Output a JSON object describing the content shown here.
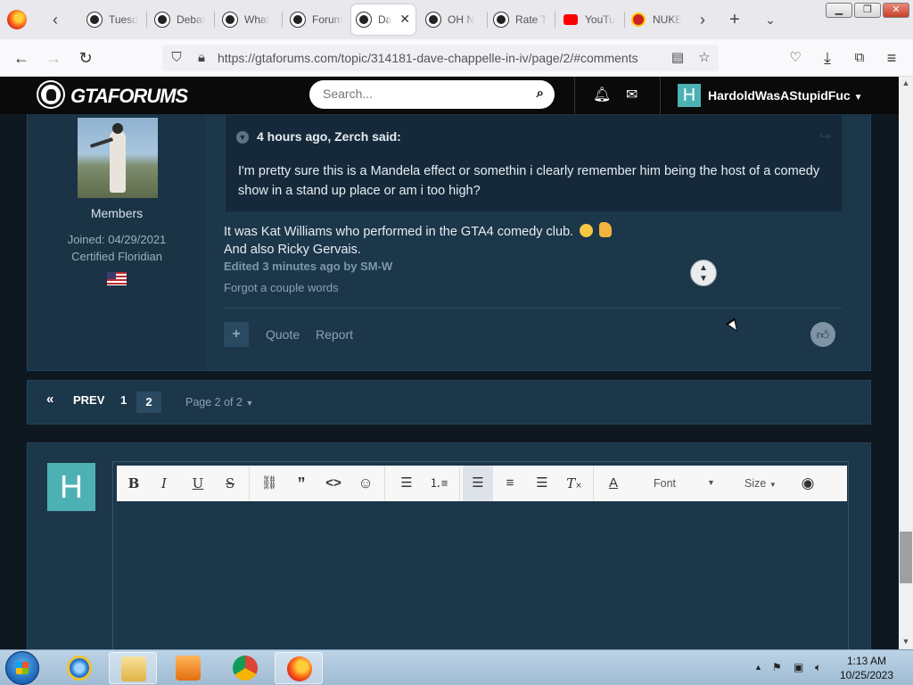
{
  "browser": {
    "tabs": [
      {
        "title": "Tuesd",
        "favicon": "gtaforums-icon"
      },
      {
        "title": "Debat",
        "favicon": "gtaforums-icon"
      },
      {
        "title": "What",
        "favicon": "gtaforums-icon"
      },
      {
        "title": "Forum",
        "favicon": "gtaforums-icon"
      },
      {
        "title": "Da",
        "favicon": "gtaforums-icon",
        "active": true
      },
      {
        "title": "OH N",
        "favicon": "gtaforums-icon"
      },
      {
        "title": "Rate T",
        "favicon": "gtaforums-icon"
      },
      {
        "title": "YouTu",
        "favicon": "youtube-icon"
      },
      {
        "title": "NUKE",
        "favicon": "nuke-icon"
      }
    ],
    "url": "https://gtaforums.com/topic/314181-dave-chappelle-in-iv/page/2/#comments"
  },
  "site": {
    "logo_text": "GTAFORUMS",
    "search_placeholder": "Search...",
    "user_initial": "H",
    "username": "HardoldWasAStupidFuc"
  },
  "post": {
    "author": {
      "group": "Members",
      "joined": "Joined: 04/29/2021",
      "title": "Certified Floridian"
    },
    "quote": {
      "cite": "4 hours ago, Zerch said:",
      "text": "I'm pretty sure this is a Mandela effect or somethin i clearly remember him being the host of a comedy show in a stand up place or am i too high?"
    },
    "lines": [
      "It was Kat Williams who performed in the GTA4 comedy club.",
      "And also Ricky Gervais."
    ],
    "edited": "Edited 3 minutes ago by SM-W",
    "edit_reason": "Forgot a couple words",
    "actions": {
      "quote": "Quote",
      "report": "Report"
    }
  },
  "pagination": {
    "prev": "PREV",
    "pages": [
      "1",
      "2"
    ],
    "current": "2",
    "info": "Page 2 of 2"
  },
  "reply": {
    "avatar_initial": "H",
    "toolbar": {
      "font": "Font",
      "size": "Size"
    }
  },
  "taskbar": {
    "time": "1:13 AM",
    "date": "10/25/2023"
  },
  "colors": {
    "post_bg": "#1c364a",
    "page_bg": "#0e1821",
    "accent": "#4db1b4"
  }
}
